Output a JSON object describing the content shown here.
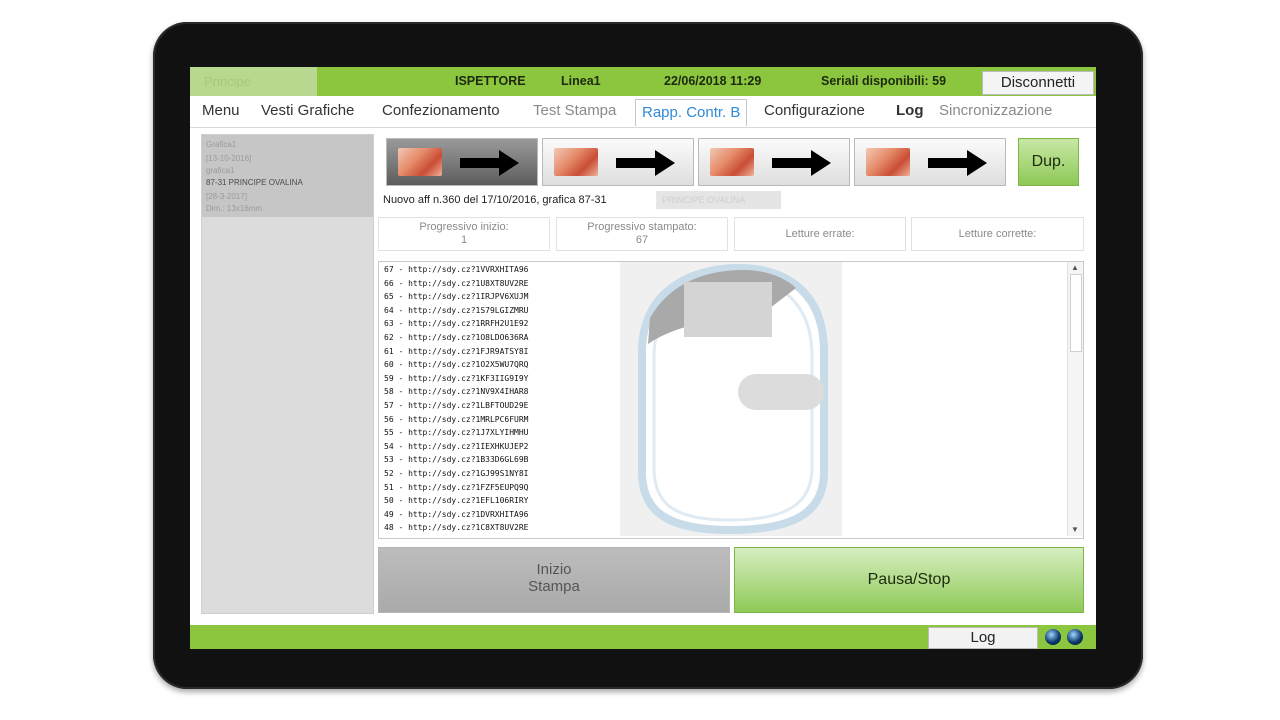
{
  "topbar": {
    "logo": "Principe",
    "user": "ISPETTORE",
    "line": "Linea1",
    "datetime": "22/06/2018 11:29",
    "serials": "Seriali disponibili: 59",
    "disconnect_label": "Disconnetti"
  },
  "tabs": [
    {
      "label": "Menu"
    },
    {
      "label": "Vesti Grafiche"
    },
    {
      "label": "Confezionamento"
    },
    {
      "label": "Test Stampa"
    },
    {
      "label": "Rapp. Contr. B"
    },
    {
      "label": "Configurazione"
    },
    {
      "label": "Log"
    },
    {
      "label": "Sincronizzazione"
    }
  ],
  "left_list": {
    "item_name": "Grafica1",
    "item_date": "[13-10-2016]",
    "item_sub": "grafica1",
    "item_product": "87-31 PRINCIPE OVALINA",
    "item_date2": "[28-3-2017]",
    "item_dim": "Dim.: 13x16mm"
  },
  "dup_label": "Dup.",
  "info_text": "Nuovo aff n.360 del 17/10/2016, grafica 87-31",
  "info_blur": "PRINCIPE OVALINA",
  "counters": {
    "inizio_label": "Progressivo  inizio:",
    "inizio_value": "1",
    "stampato_label": "Progressivo  stampato:",
    "stampato_value": "67",
    "errate_label": "Letture errate:",
    "corrette_label": "Letture corrette:"
  },
  "log_lines": [
    "67 - http://sdy.cz?1VVRXHITA96",
    "66 - http://sdy.cz?1U8XT8UV2RE",
    "65 - http://sdy.cz?1IRJPV6XUJM",
    "64 - http://sdy.cz?1S79LGIZMRU",
    "63 - http://sdy.cz?1RRFH2U1E92",
    "62 - http://sdy.cz?1O8LDO636RA",
    "61 - http://sdy.cz?1FJR9ATSY8I",
    "60 - http://sdy.cz?1O2X5WU7QRQ",
    "59 - http://sdy.cz?1KF3IIG9I9Y",
    "58 - http://sdy.cz?1NV9X4IHAR8",
    "57 - http://sdy.cz?1LBFTOUD29E",
    "56 - http://sdy.cz?1MRLPC6FURM",
    "55 - http://sdy.cz?1J7XLYIHMHU",
    "54 - http://sdy.cz?1IEXHKUJEP2",
    "53 - http://sdy.cz?1B33D6GL69B",
    "52 - http://sdy.cz?1GJ99S1NY8I",
    "51 - http://sdy.cz?1FZF5EUPQ9Q",
    "50 - http://sdy.cz?1EFL106RIRY",
    "49 - http://sdy.cz?1DVRXHITA96",
    "48 - http://sdy.cz?1C8XT8UV2RE"
  ],
  "start_label_1": "Inizio",
  "start_label_2": "Stampa",
  "pause_label": "Pausa/Stop",
  "bottom_log_label": "Log",
  "colors": {
    "accent_green": "#8bc63e",
    "active_tab": "#2f8ad8"
  }
}
